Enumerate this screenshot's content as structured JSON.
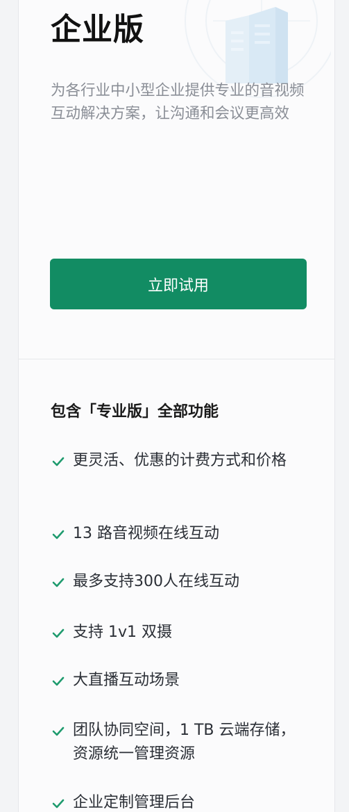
{
  "plan": {
    "title": "企业版",
    "description": "为各行业中小型企业提供专业的音视频互动解决方案，让沟通和会议更高效",
    "cta_label": "立即试用"
  },
  "features": {
    "title": "包含「专业版」全部功能",
    "items": [
      "更灵活、优惠的计费方式和价格",
      "13 路音视频在线互动",
      "最多支持300人在线互动",
      "支持 1v1 双摄",
      "大直播互动场景",
      "团队协同空间，1 TB 云端存储，资源统一管理资源",
      "企业定制管理后台"
    ]
  },
  "colors": {
    "accent": "#128c63",
    "check": "#1f9b6e"
  },
  "icons": {
    "feature_bullet": "check-icon",
    "header_art": "building-illustration"
  }
}
